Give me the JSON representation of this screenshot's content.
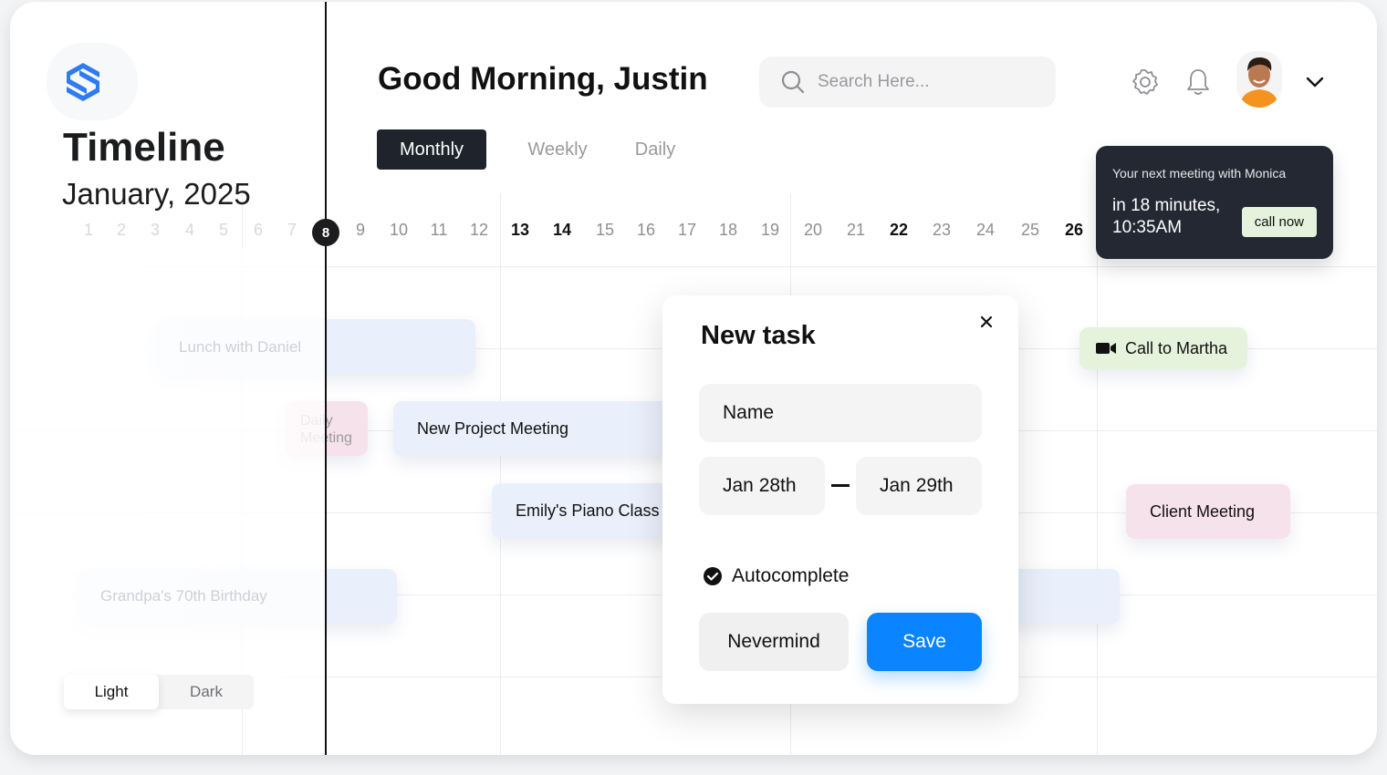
{
  "app": {
    "title": "Timeline",
    "subtitle": "January, 2025",
    "greeting": "Good Morning, Justin"
  },
  "search": {
    "placeholder": "Search Here..."
  },
  "tabs": [
    {
      "label": "Monthly",
      "active": true
    },
    {
      "label": "Weekly",
      "active": false
    },
    {
      "label": "Daily",
      "active": false
    }
  ],
  "calendar": {
    "current_day": "8",
    "days": [
      "1",
      "2",
      "3",
      "4",
      "5",
      "6",
      "7",
      "9",
      "10",
      "11",
      "12",
      "13",
      "14",
      "15",
      "16",
      "17",
      "18",
      "19",
      "20",
      "21",
      "22",
      "23",
      "24",
      "25",
      "26"
    ],
    "bold_days": [
      "13",
      "14",
      "22",
      "26"
    ]
  },
  "events": {
    "lunch": "Lunch with Daniel",
    "daily_meeting": "Daily Meeting",
    "new_project": "New Project Meeting",
    "piano": "Emily's Piano Class",
    "birthday": "Grandpa's 70th Birthday",
    "martha": "Call to Martha",
    "client": "Client Meeting"
  },
  "notification": {
    "header": "Your next meeting with Monica",
    "time": "in 18 minutes, 10:35AM",
    "action": "call now"
  },
  "modal": {
    "title": "New task",
    "name_value": "Name",
    "start_date": "Jan 28th",
    "end_date": "Jan 29th",
    "autocomplete_label": "Autocomplete",
    "cancel_label": "Nevermind",
    "save_label": "Save"
  },
  "theme": {
    "light": "Light",
    "dark": "Dark",
    "selected": "Light"
  },
  "colors": {
    "accent": "#0a84ff",
    "logo": "#2f7bf2",
    "dark_panel": "#232833",
    "event_blue": "#e9effb",
    "event_pink": "#f6e2ea",
    "event_green": "#e5f2dc"
  }
}
